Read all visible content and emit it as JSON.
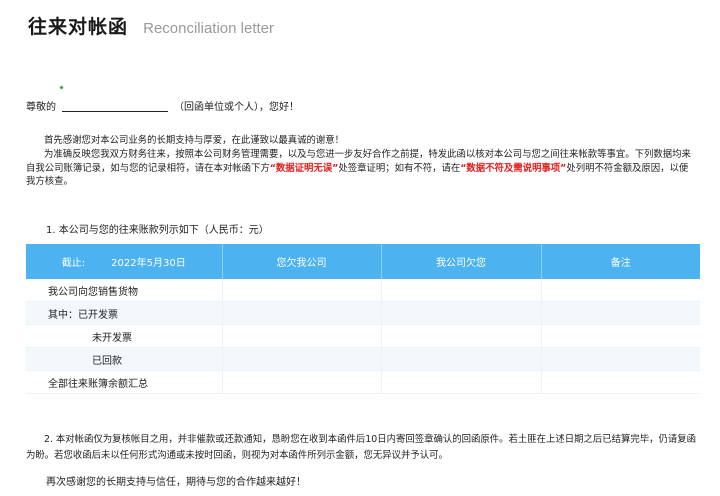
{
  "header": {
    "title_cn": "往来对帐函",
    "title_en": "Reconciliation letter"
  },
  "greeting": {
    "salutation": "尊敬的",
    "suffix": "（回函单位或个人），您好！"
  },
  "paragraphs": {
    "thanks": "首先感谢您对本公司业务的长期支持与厚爱，在此谨致以最真诚的谢意！",
    "purpose_1": "为准确反映您我双方财务往来，按照本公司财务管理需要，以及与您进一步友好合作之前提，特发此函以核对本公司与您之间往来帐款等事宜。下列数据均来自我公司账簿记录，如与您的记录相符，请在本对帐函下方",
    "highlight_1": "“数据证明无误”",
    "purpose_2": "处签章证明；如有不符，请在",
    "highlight_2": "“数据不符及需说明事项”",
    "purpose_3": "处列明不符金额及原因，以便我方核查。"
  },
  "section1": {
    "title": "1.  本公司与您的往来账款列示如下（人民币：元）"
  },
  "table": {
    "headers": {
      "cutoff_label": "截止:",
      "cutoff_date": "2022年5月30日",
      "col_we_owe": "您欠我公司",
      "col_you_owe": "我公司欠您",
      "col_notes": "备注"
    },
    "rows": [
      {
        "label": "我公司向您销售货物",
        "indent": 1
      },
      {
        "label": "其中：已开发票",
        "indent": 0
      },
      {
        "label": "未开发票",
        "indent": 2
      },
      {
        "label": "已回款",
        "indent": 2
      },
      {
        "label": "全部往来账簿余额汇总",
        "indent": 1
      }
    ]
  },
  "section2": {
    "text": "2.  本对帐函仅为复核帐目之用，并非催款或还款通知，恳盼您在收到本函件后10日内寄回签章确认的回函原件。若土匪在上述日期之后已结算完毕，仍请复函为盼。若您收函后未以任何形式沟通或未按时回函，则视为对本函件所列示金额，您无异议并予认可。"
  },
  "closing": {
    "text": "再次感谢您的长期支持与信任，期待与您的合作越来越好！"
  },
  "colors": {
    "header_blue": "#4db3f0",
    "highlight_red": "#e02020",
    "row_alt": "#f3f8fc"
  }
}
